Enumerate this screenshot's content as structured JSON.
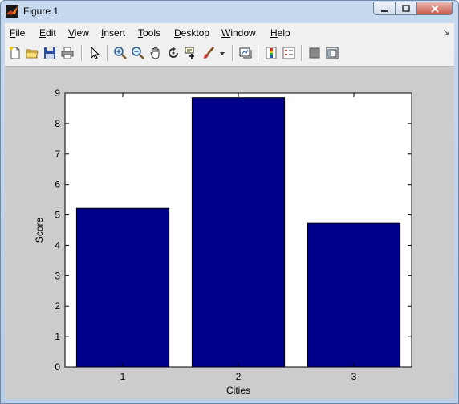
{
  "window": {
    "title": "Figure 1"
  },
  "menu": [
    {
      "label": "File",
      "key": "F",
      "rest": "ile"
    },
    {
      "label": "Edit",
      "key": "E",
      "rest": "dit"
    },
    {
      "label": "View",
      "key": "V",
      "rest": "iew"
    },
    {
      "label": "Insert",
      "key": "I",
      "rest": "nsert"
    },
    {
      "label": "Tools",
      "key": "T",
      "rest": "ools"
    },
    {
      "label": "Desktop",
      "key": "D",
      "rest": "esktop"
    },
    {
      "label": "Window",
      "key": "W",
      "rest": "indow"
    },
    {
      "label": "Help",
      "key": "H",
      "rest": "elp"
    }
  ],
  "toolbar_icons": [
    "new-figure-icon",
    "open-file-icon",
    "save-icon",
    "print-icon",
    "select-arrow-icon",
    "zoom-in-icon",
    "zoom-out-icon",
    "pan-hand-icon",
    "rotate-3d-icon",
    "data-cursor-icon",
    "brush-icon",
    "brush-dropdown-icon",
    "link-plot-icon",
    "colorbar-icon",
    "legend-icon",
    "hide-plot-tools-icon",
    "show-plot-tools-icon"
  ],
  "chart_data": {
    "type": "bar",
    "categories": [
      "1",
      "2",
      "3"
    ],
    "values": [
      5.22,
      8.85,
      4.72
    ],
    "title": "",
    "xlabel": "Cities",
    "ylabel": "Score",
    "ylim": [
      0,
      9
    ],
    "yticks": [
      0,
      1,
      2,
      3,
      4,
      5,
      6,
      7,
      8,
      9
    ],
    "bar_color": "#00008b",
    "grid": false
  }
}
